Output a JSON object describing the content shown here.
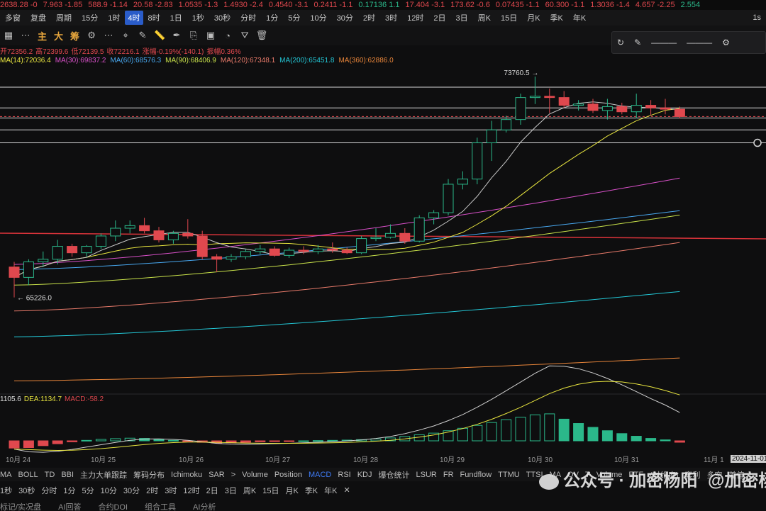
{
  "ticker": [
    {
      "text": "2638.28",
      "chg": "-0",
      "dir": "dn"
    },
    {
      "text": "7.963",
      "chg": "-1.85",
      "dir": "dn"
    },
    {
      "text": "588.9",
      "chg": "-1.14",
      "dir": "dn"
    },
    {
      "text": "20.58",
      "chg": "-2.83",
      "dir": "dn"
    },
    {
      "text": "1.0535",
      "chg": "-1.3",
      "dir": "dn"
    },
    {
      "text": "1.4930",
      "chg": "-2.4",
      "dir": "dn"
    },
    {
      "text": "0.4540",
      "chg": "-3.1",
      "dir": "dn"
    },
    {
      "text": "0.2411",
      "chg": "-1.1",
      "dir": "dn"
    },
    {
      "text": "0.17136",
      "chg": "1.1",
      "dir": "up"
    },
    {
      "text": "17.404",
      "chg": "-3.1",
      "dir": "dn"
    },
    {
      "text": "173.62",
      "chg": "-0.6",
      "dir": "dn"
    },
    {
      "text": "0.07435",
      "chg": "-1.1",
      "dir": "dn"
    },
    {
      "text": "60.300",
      "chg": "-1.1",
      "dir": "dn"
    },
    {
      "text": "1.3036",
      "chg": "-1.4",
      "dir": "dn"
    },
    {
      "text": "4.657",
      "chg": "-2.25",
      "dir": "dn"
    },
    {
      "text": "2.554",
      "chg": "",
      "dir": "up"
    }
  ],
  "toolbar1": {
    "items": [
      "多窗",
      "复盘",
      "周期",
      "15分",
      "1时",
      "4时",
      "8时",
      "1日",
      "1秒",
      "30秒",
      "分时",
      "1分",
      "5分",
      "10分",
      "30分",
      "2时",
      "3时",
      "12时",
      "2日",
      "3日",
      "周K",
      "15日",
      "月K",
      "季K",
      "年K"
    ],
    "active": "4时",
    "right": "1s"
  },
  "toolbar2": {
    "labels": [
      "主",
      "大",
      "筹"
    ],
    "icons": [
      "crosshair-icon",
      "pencil-icon",
      "ruler-icon",
      "pen-icon",
      "copy-icon",
      "image-icon",
      "magnet-icon",
      "filter-icon",
      "trash-icon"
    ]
  },
  "floatpanel": {
    "line1": "———",
    "line2": "———"
  },
  "ohlc": {
    "open": "开72356.2",
    "high": "高72399.6",
    "low": "低72139.5",
    "close": "收72216.1",
    "change": "涨幅-0.19%(-140.1)",
    "amplitude": "振幅0.36%"
  },
  "ma_legend": [
    {
      "label": "MA(14):72036.4",
      "color": "#e8e53f"
    },
    {
      "label": "MA(30):69837.2",
      "color": "#d850c8"
    },
    {
      "label": "MA(60):68576.3",
      "color": "#48a8f0"
    },
    {
      "label": "MA(90):68406.9",
      "color": "#c9e24a"
    },
    {
      "label": "MA(120):67348.1",
      "color": "#e87a6a"
    },
    {
      "label": "MA(200):65451.8",
      "color": "#23c7d6"
    },
    {
      "label": "MA(360):62886.0",
      "color": "#e8853a"
    }
  ],
  "annotations": {
    "high": "73760.5",
    "low": "← 65226.0"
  },
  "macd_legend": {
    "dif": "1105.6",
    "dea": "DEA:1134.7",
    "macd": "MACD:-58.2"
  },
  "time_axis": [
    "10月 24",
    "10月 25",
    "10月 26",
    "10月 27",
    "10月 28",
    "10月 29",
    "10月 30",
    "10月 31",
    "11月 1",
    "2024-11-01"
  ],
  "indicators": [
    "MA",
    "BOLL",
    "TD",
    "BBI",
    "主力大单跟踪",
    "筹码分布",
    "Ichimoku",
    "SAR",
    ">",
    "Volume",
    "Position",
    "MACD",
    "RSI",
    "KDJ",
    "爆仓统计",
    "LSUR",
    "FR",
    "Fundflow",
    "TTMU",
    "TTSI",
    "MA",
    "OV",
    "T",
    "Volume",
    "ETF",
    "(时维度)",
    "套利",
    "多空",
    "差值"
  ],
  "indicator_selected": "MACD",
  "timeframes": [
    "1秒",
    "30秒",
    "分时",
    "1分",
    "5分",
    "10分",
    "30分",
    "2时",
    "3时",
    "12时",
    "2日",
    "3日",
    "周K",
    "15日",
    "月K",
    "季K",
    "年K"
  ],
  "bottom_tabs": [
    "标记/实况盘",
    "AI回答",
    "合约DOI",
    "组合工具",
    "AI分析"
  ],
  "watermark": {
    "text1": "公众号 · 加密杨阳",
    "text2": "@加密杨阳"
  },
  "chart_data": {
    "type": "candlestick",
    "interval": "4时",
    "x": [
      "10-24 04",
      "10-24 08",
      "10-24 12",
      "10-24 16",
      "10-24 20",
      "10-25 00",
      "10-25 04",
      "10-25 08",
      "10-25 12",
      "10-25 16",
      "10-25 20",
      "10-26 00",
      "10-26 04",
      "10-26 08",
      "10-26 12",
      "10-26 16",
      "10-26 20",
      "10-27 00",
      "10-27 04",
      "10-27 08",
      "10-27 12",
      "10-27 16",
      "10-27 20",
      "10-28 00",
      "10-28 04",
      "10-28 08",
      "10-28 12",
      "10-28 16",
      "10-28 20",
      "10-29 00",
      "10-29 04",
      "10-29 08",
      "10-29 12",
      "10-29 16",
      "10-29 20",
      "10-30 00",
      "10-30 04",
      "10-30 08",
      "10-30 12",
      "10-30 16",
      "10-30 20",
      "10-31 00",
      "10-31 04",
      "10-31 08",
      "10-31 12",
      "10-31 16",
      "10-31 20"
    ],
    "candles": [
      [
        66400,
        66600,
        65226,
        66000
      ],
      [
        66000,
        66700,
        65700,
        66600
      ],
      [
        66600,
        67000,
        66400,
        66700
      ],
      [
        66700,
        67450,
        66500,
        67200
      ],
      [
        67200,
        67300,
        66800,
        66950
      ],
      [
        66950,
        67250,
        66800,
        67200
      ],
      [
        67200,
        67700,
        67100,
        67600
      ],
      [
        67600,
        68200,
        67400,
        67900
      ],
      [
        67900,
        68200,
        67700,
        68000
      ],
      [
        68000,
        68300,
        67700,
        67800
      ],
      [
        67800,
        67950,
        67350,
        67450
      ],
      [
        67450,
        67800,
        67300,
        67700
      ],
      [
        67700,
        68250,
        67500,
        67600
      ],
      [
        67600,
        67800,
        66700,
        66800
      ],
      [
        66800,
        66900,
        66200,
        66700
      ],
      [
        66700,
        66900,
        66600,
        66800
      ],
      [
        66800,
        67100,
        66700,
        67000
      ],
      [
        67000,
        67250,
        66900,
        67100
      ],
      [
        67100,
        67200,
        66800,
        66850
      ],
      [
        66850,
        67150,
        66750,
        67050
      ],
      [
        67050,
        67200,
        66900,
        67000
      ],
      [
        67000,
        67250,
        66900,
        67100
      ],
      [
        67100,
        67350,
        66950,
        67050
      ],
      [
        67050,
        67150,
        66900,
        66950
      ],
      [
        66950,
        67600,
        66900,
        67500
      ],
      [
        67500,
        67900,
        67400,
        67550
      ],
      [
        67550,
        68050,
        67500,
        67700
      ],
      [
        67700,
        67900,
        67300,
        67400
      ],
      [
        67400,
        68400,
        67350,
        68300
      ],
      [
        68300,
        68600,
        68050,
        68500
      ],
      [
        68500,
        69800,
        68400,
        69600
      ],
      [
        69600,
        70100,
        69400,
        69800
      ],
      [
        69800,
        71400,
        69600,
        71200
      ],
      [
        71200,
        72050,
        70500,
        71700
      ],
      [
        71700,
        72250,
        71600,
        72100
      ],
      [
        72100,
        73100,
        71900,
        72950
      ],
      [
        72950,
        73760.5,
        72700,
        73000
      ],
      [
        73000,
        73300,
        72350,
        72950
      ],
      [
        72950,
        73200,
        72550,
        72650
      ],
      [
        72650,
        72850,
        72450,
        72700
      ],
      [
        72700,
        72900,
        72350,
        72450
      ],
      [
        72450,
        72900,
        72100,
        72600
      ],
      [
        72600,
        72750,
        72300,
        72400
      ],
      [
        72400,
        73100,
        72150,
        72650
      ],
      [
        72650,
        72850,
        72250,
        72550
      ],
      [
        72550,
        72900,
        72300,
        72500
      ],
      [
        72500,
        72600,
        72139.5,
        72216.1
      ]
    ],
    "price_levels": [
      73350,
      72550,
      72160,
      71700,
      71200
    ],
    "red_level": 67600,
    "macd_hist": [
      -300,
      -280,
      -200,
      -120,
      -40,
      20,
      60,
      90,
      110,
      100,
      60,
      20,
      -20,
      -60,
      -90,
      -80,
      -60,
      -40,
      -20,
      -10,
      0,
      10,
      20,
      30,
      50,
      80,
      120,
      180,
      250,
      320,
      420,
      520,
      640,
      760,
      880,
      980,
      1080,
      1120,
      900,
      720,
      560,
      420,
      300,
      190,
      100,
      40,
      -58.2
    ]
  }
}
